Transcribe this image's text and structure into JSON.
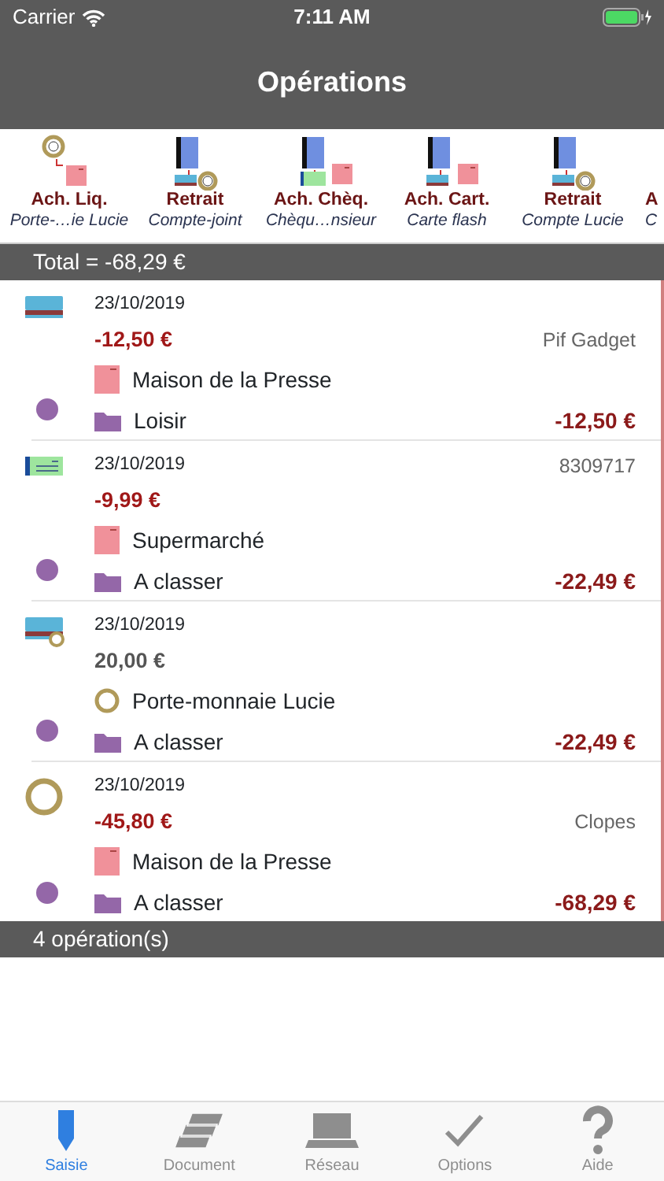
{
  "status_bar": {
    "carrier": "Carrier",
    "time": "7:11 AM"
  },
  "nav": {
    "title": "Opérations"
  },
  "templates": [
    {
      "kind": "cash",
      "title": "Ach. Liq.",
      "subtitle": "Porte-…ie Lucie"
    },
    {
      "kind": "withdrawal",
      "title": "Retrait",
      "subtitle": "Compte-joint"
    },
    {
      "kind": "cheque",
      "title": "Ach. Chèq.",
      "subtitle": "Chèqu…nsieur"
    },
    {
      "kind": "card",
      "title": "Ach. Cart.",
      "subtitle": "Carte flash"
    },
    {
      "kind": "withdrawal",
      "title": "Retrait",
      "subtitle": "Compte Lucie"
    },
    {
      "title": "A",
      "subtitle": "C"
    }
  ],
  "total": "Total = -68,29 €",
  "operations": [
    {
      "kind": "card",
      "date": "23/10/2019",
      "amount": "-12,50 €",
      "debit": true,
      "memo": "Pif Gadget",
      "payee": {
        "kind": "shop",
        "name": "Maison de la Presse"
      },
      "color": "#9467a8",
      "category": "Loisir",
      "balance": "-12,50 €"
    },
    {
      "kind": "cheque",
      "date": "23/10/2019",
      "reference": "8309717",
      "amount": "-9,99 €",
      "debit": true,
      "payee": {
        "kind": "shop",
        "name": "Supermarché"
      },
      "color": "#9467a8",
      "category": "A classer",
      "balance": "-22,49 €"
    },
    {
      "kind": "transfer",
      "date": "23/10/2019",
      "amount": "20,00 €",
      "debit": false,
      "payee": {
        "kind": "purse",
        "name": "Porte-monnaie Lucie"
      },
      "color": "#9467a8",
      "category": "A classer",
      "balance": "-22,49 €"
    },
    {
      "kind": "cash",
      "date": "23/10/2019",
      "amount": "-45,80 €",
      "debit": true,
      "memo": "Clopes",
      "payee": {
        "kind": "shop",
        "name": "Maison de la Presse"
      },
      "color": "#9467a8",
      "category": "A classer",
      "balance": "-68,29 €"
    }
  ],
  "count": "4 opération(s)",
  "tabs": [
    {
      "label": "Saisie",
      "selected": true
    },
    {
      "label": "Document",
      "selected": false
    },
    {
      "label": "Réseau",
      "selected": false
    },
    {
      "label": "Options",
      "selected": false
    },
    {
      "label": "Aide",
      "selected": false
    }
  ]
}
